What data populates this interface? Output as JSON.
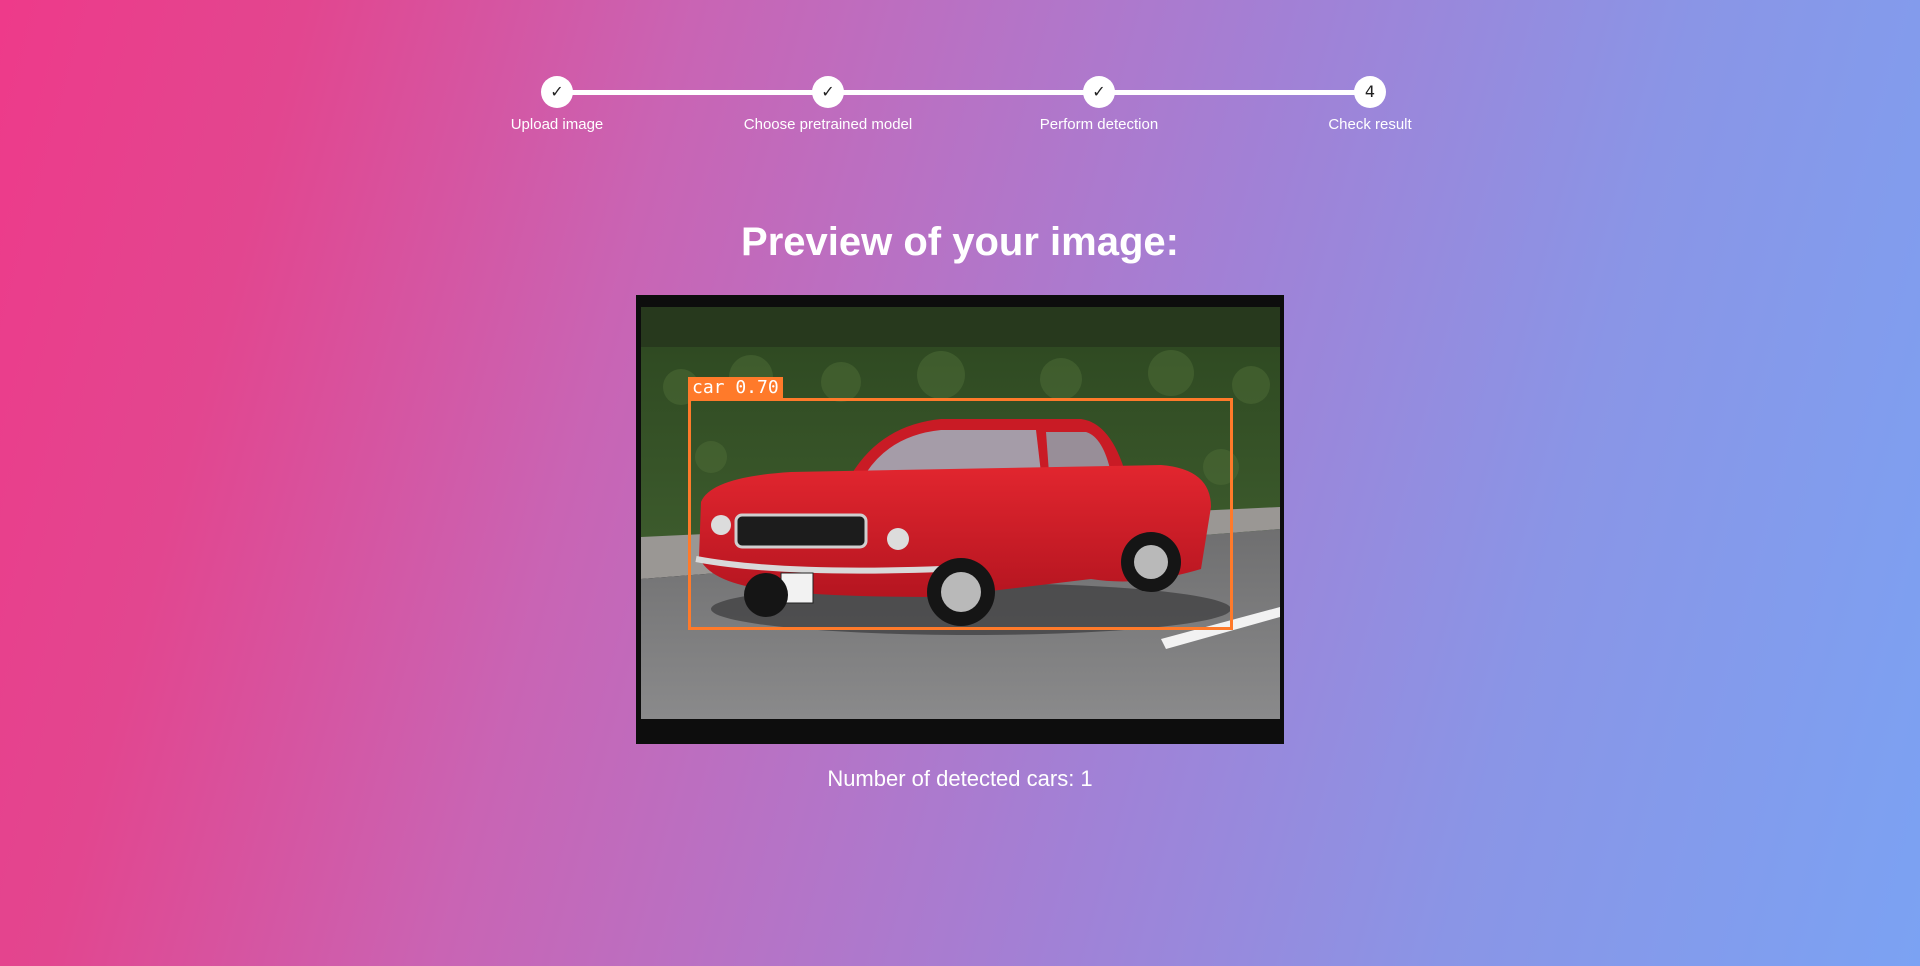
{
  "stepper": {
    "steps": [
      {
        "marker": "✓",
        "label": "Upload image",
        "status": "completed"
      },
      {
        "marker": "✓",
        "label": "Choose pretrained model",
        "status": "completed"
      },
      {
        "marker": "✓",
        "label": "Perform detection",
        "status": "completed"
      },
      {
        "marker": "4",
        "label": "Check result",
        "status": "current"
      }
    ]
  },
  "preview": {
    "title": "Preview of your image:",
    "detection_label": "car 0.70"
  },
  "result": {
    "text": "Number of detected cars: 1"
  },
  "colors": {
    "gradient_start": "#ee3a8a",
    "gradient_end": "#7ba2f3",
    "bbox": "#ff7a2a"
  }
}
